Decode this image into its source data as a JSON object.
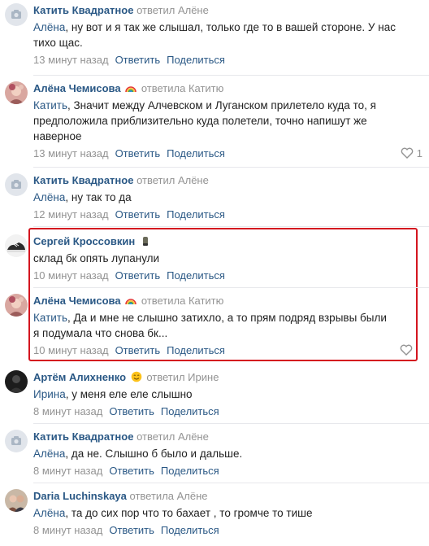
{
  "comments": [
    {
      "author": "Катить Квадратное",
      "replied": "ответил Алёне",
      "mention": "Алёна",
      "text_lines": [
        ", ну вот и я так же слышал, только где то в вашей стороне. У нас",
        "тихо щас."
      ],
      "time": "13 минут назад",
      "reply": "Ответить",
      "share": "Поделиться",
      "likes": ""
    },
    {
      "author": "Алёна Чемисова",
      "replied": "ответила Катитю",
      "mention": "Катить",
      "text_lines": [
        ", Значит между Алчевском и Луганском прилетело куда то, я",
        "предположила приблизительно куда полетели, точно напишут же",
        "наверное"
      ],
      "time": "13 минут назад",
      "reply": "Ответить",
      "share": "Поделиться",
      "likes": "1"
    },
    {
      "author": "Катить Квадратное",
      "replied": "ответил Алёне",
      "mention": "Алёна",
      "text_lines": [
        ", ну так то да"
      ],
      "time": "12 минут назад",
      "reply": "Ответить",
      "share": "Поделиться",
      "likes": ""
    },
    {
      "author": "Сергей Кроссовкин",
      "replied": "",
      "mention": "",
      "text_lines": [
        "склад бк опять лупанули"
      ],
      "time": "10 минут назад",
      "reply": "Ответить",
      "share": "Поделиться",
      "likes": ""
    },
    {
      "author": "Алёна Чемисова",
      "replied": "ответила Катитю",
      "mention": "Катить",
      "text_lines": [
        ", Да и мне не слышно затихло, а то прям подряд взрывы были",
        "я подумала что снова бк..."
      ],
      "time": "10 минут назад",
      "reply": "Ответить",
      "share": "Поделиться",
      "likes": ""
    },
    {
      "author": "Артём Алихненко",
      "replied": "ответил Ирине",
      "mention": "Ирина",
      "text_lines": [
        ", у меня еле еле слышно"
      ],
      "time": "8 минут назад",
      "reply": "Ответить",
      "share": "Поделиться",
      "likes": ""
    },
    {
      "author": "Катить Квадратное",
      "replied": "ответил Алёне",
      "mention": "Алёна",
      "text_lines": [
        ", да не. Слышно б было и дальше."
      ],
      "time": "8 минут назад",
      "reply": "Ответить",
      "share": "Поделиться",
      "likes": ""
    },
    {
      "author": "Daria Luchinskaya",
      "replied": "ответила Алёне",
      "mention": "Алёна",
      "text_lines": [
        ", та до сих пор что то бахает , то громче то тише"
      ],
      "time": "8 минут назад",
      "reply": "Ответить",
      "share": "Поделиться",
      "likes": ""
    }
  ],
  "colors": {
    "link": "#2a5885",
    "muted": "#939393",
    "highlight": "#d4151f"
  },
  "icons": [
    "camera-placeholder-icon",
    "rainbow-emoji-icon",
    "sneaker-emoji-icon",
    "smile-emoji-icon",
    "heart-icon"
  ]
}
